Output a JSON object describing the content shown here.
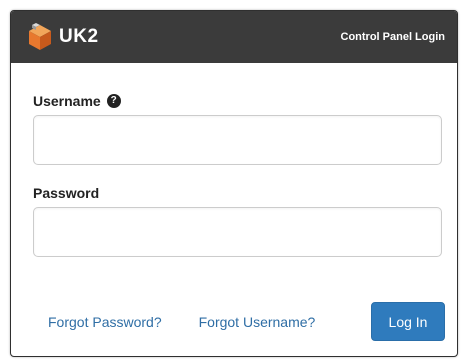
{
  "header": {
    "brand_name": "UK2",
    "title": "Control Panel Login",
    "logo_icon": "cube-logo-icon",
    "background_color": "#3b3b3b"
  },
  "form": {
    "username": {
      "label": "Username",
      "help_icon": "?",
      "value": "",
      "placeholder": ""
    },
    "password": {
      "label": "Password",
      "value": "",
      "placeholder": ""
    }
  },
  "footer": {
    "forgot_password": "Forgot Password?",
    "forgot_username": "Forgot Username?",
    "login_label": "Log In",
    "link_color": "#2f6ea5",
    "button_color": "#2f7bbd"
  }
}
